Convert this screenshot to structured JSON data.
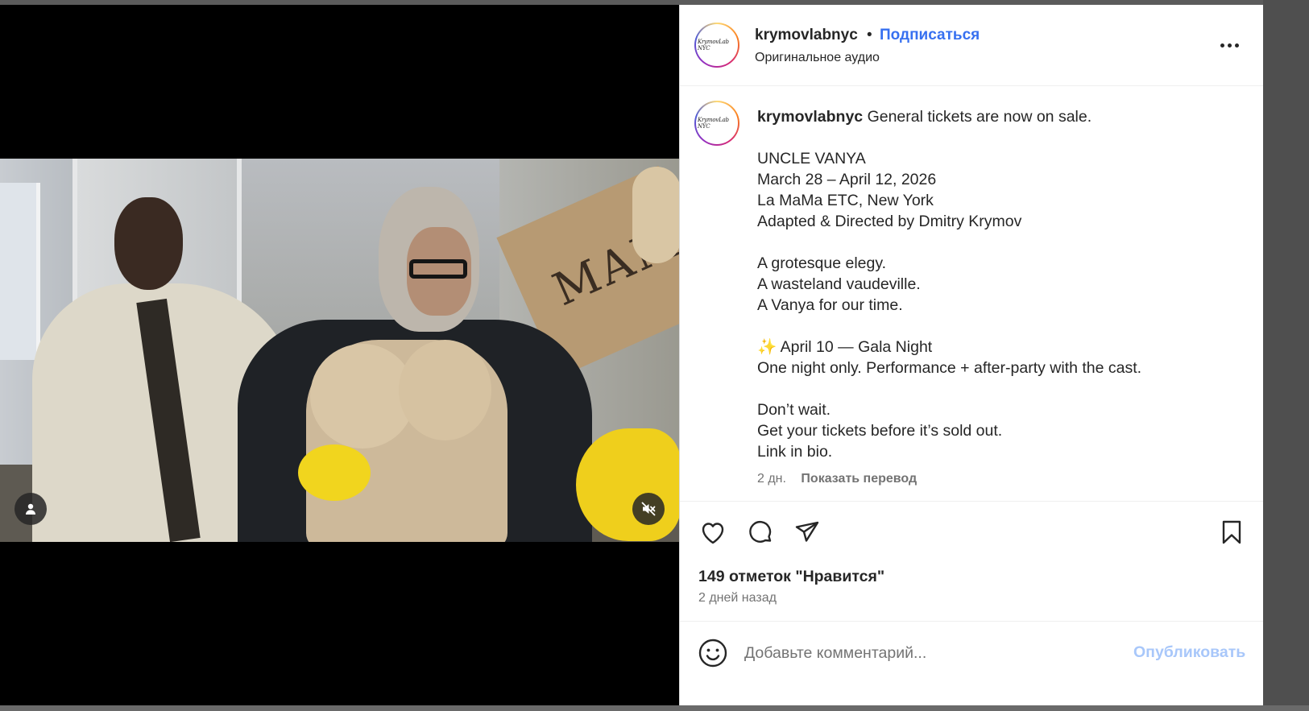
{
  "post": {
    "username": "krymovlabnyc",
    "separator": "•",
    "follow_label": "Подписаться",
    "audio_label": "Оригинальное аудио",
    "avatar_text": "KrymovLab NYC",
    "more_icon": "more-horizontal-icon",
    "video_sign_text": "MAMA",
    "caption": {
      "lead": "General tickets are now on sale.",
      "blocks": [
        [
          "UNCLE VANYA",
          "March 28 – April 12, 2026",
          "La MaMa ETC, New York",
          "Adapted & Directed by Dmitry Krymov"
        ],
        [
          "A grotesque elegy.",
          "A wasteland vaudeville.",
          "A Vanya for our time."
        ],
        [
          "✨ April 10 — Gala Night",
          "One night only. Performance + after-party with the cast."
        ],
        [
          "Don’t wait.",
          "Get your tickets before it’s sold out.",
          "Link in bio."
        ]
      ]
    },
    "time_ago": "2 дн.",
    "translate_label": "Показать перевод",
    "likes_text": "149 отметок \"Нравится\"",
    "date_text": "2 дней назад",
    "comment_placeholder": "Добавьте комментарий...",
    "publish_label": "Опубликовать",
    "icons": {
      "like": "heart-icon",
      "comment": "comment-bubble-icon",
      "share": "paper-plane-icon",
      "save": "bookmark-icon",
      "emoji": "emoji-smile-icon",
      "tagged_users": "user-icon",
      "mute": "speaker-muted-icon"
    },
    "colors": {
      "follow": "#3770f0",
      "publish_disabled": "#a8c7fa",
      "secondary_text": "#737373"
    }
  }
}
